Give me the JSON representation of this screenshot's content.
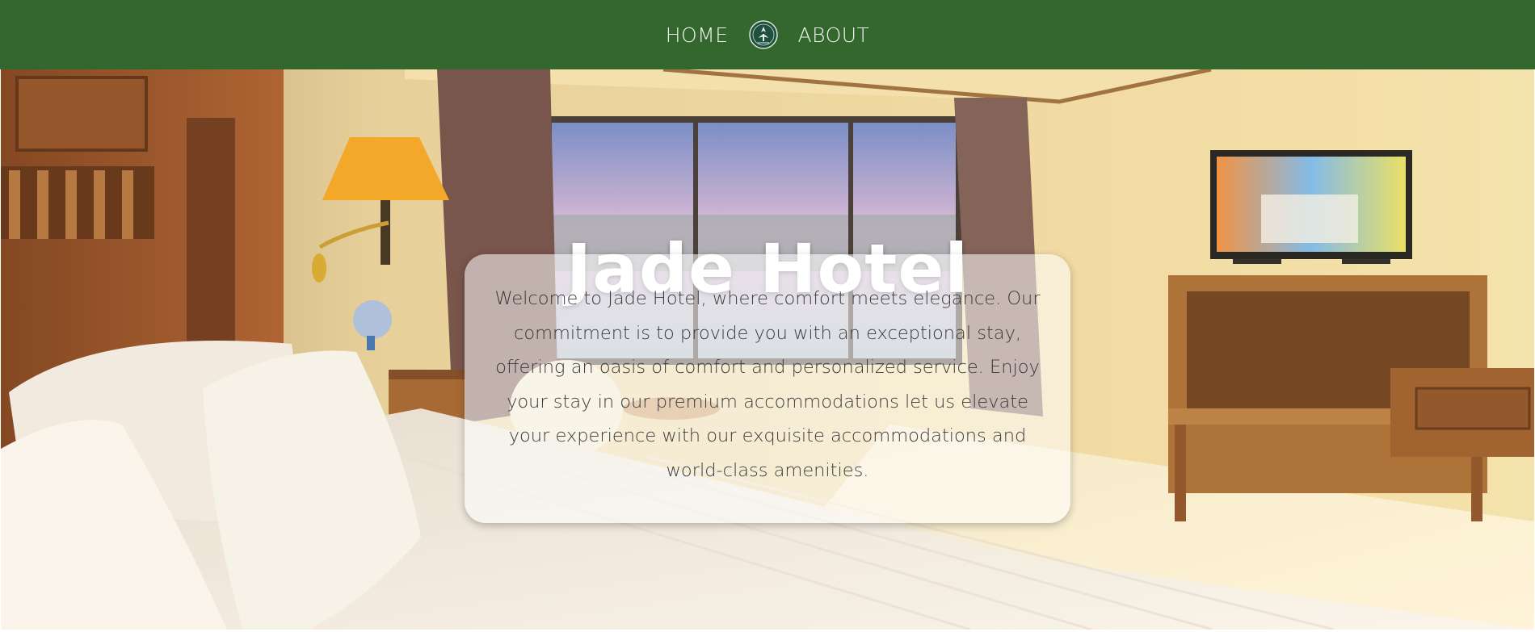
{
  "nav": {
    "home_label": "HOME",
    "about_label": "ABOUT",
    "logo_icon": "hotel-crest-logo-icon"
  },
  "hero": {
    "title": "Jade Hotel",
    "description": "Welcome to Jade Hotel, where comfort meets elegance. Our commitment is to provide you with an exceptional stay, offering an oasis of comfort and personalized service. Enjoy your stay in our premium accommodations let us elevate your experience with our exquisite accommodations and world-class amenities.",
    "background_image": "hotel-bedroom-photo"
  },
  "colors": {
    "navbar": "#33672d",
    "nav_text": "#f3f3f3",
    "title": "#ffffff",
    "card_text": "#3b3b3b"
  }
}
